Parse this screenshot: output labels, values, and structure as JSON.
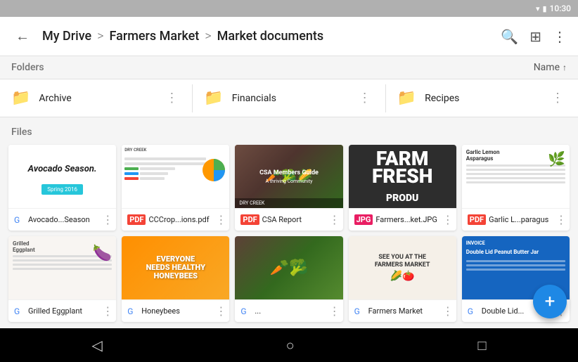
{
  "statusBar": {
    "time": "10:30",
    "wifiIcon": "▼",
    "batteryIcon": "▮"
  },
  "appBar": {
    "backLabel": "←",
    "breadcrumb": {
      "root": "My Drive",
      "sep1": ">",
      "mid": "Farmers Market",
      "sep2": ">",
      "current": "Market documents"
    },
    "searchIcon": "⌕",
    "gridIcon": "⊞",
    "moreIcon": "⋮"
  },
  "foldersSection": {
    "title": "Folders",
    "sortLabel": "Name",
    "sortArrow": "↑",
    "folders": [
      {
        "name": "Archive",
        "iconType": "dark"
      },
      {
        "name": "Financials",
        "iconType": "yellow"
      },
      {
        "name": "Recipes",
        "iconType": "purple"
      }
    ]
  },
  "filesSection": {
    "title": "Files",
    "files": [
      {
        "name": "Avocado...Season",
        "type": "doc",
        "typeLabel": "G",
        "thumb": "avocado"
      },
      {
        "name": "CCCrop...ions.pdf",
        "type": "pdf",
        "typeLabel": "PDF",
        "thumb": "spreadsheet"
      },
      {
        "name": "CSA Report",
        "type": "pdf",
        "typeLabel": "PDF",
        "thumb": "csa"
      },
      {
        "name": "Farmers...ket.JPG",
        "type": "img",
        "typeLabel": "JPG",
        "thumb": "farm"
      },
      {
        "name": "Garlic L...paragus",
        "type": "pdf",
        "typeLabel": "PDF",
        "thumb": "garlic"
      },
      {
        "name": "Grilled Eggplant",
        "type": "doc",
        "typeLabel": "G",
        "thumb": "eggplant"
      },
      {
        "name": "Honeybees",
        "type": "doc",
        "typeLabel": "G",
        "thumb": "honeybee"
      },
      {
        "name": "...",
        "type": "doc",
        "typeLabel": "G",
        "thumb": "vegetables"
      },
      {
        "name": "Farmers Market",
        "type": "doc",
        "typeLabel": "G",
        "thumb": "farmers-market"
      },
      {
        "name": "Double Lid...",
        "type": "doc",
        "typeLabel": "G",
        "thumb": "peanut"
      }
    ]
  },
  "fab": {
    "label": "+"
  },
  "bottomNav": {
    "backIcon": "◁",
    "homeIcon": "○",
    "recentIcon": "□"
  }
}
